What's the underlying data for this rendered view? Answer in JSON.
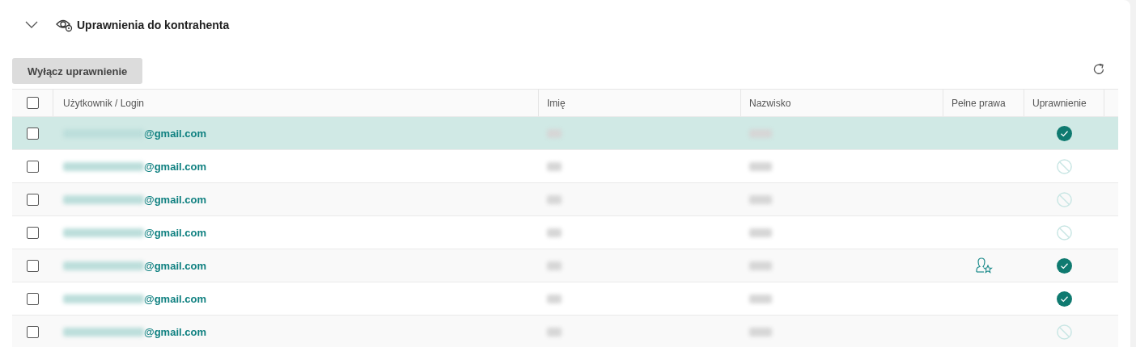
{
  "section": {
    "title": "Uprawnienia do kontrahenta",
    "expanded": true
  },
  "toolbar": {
    "button": "Wyłącz uprawnienie"
  },
  "table": {
    "header_checked": false,
    "columns": [
      "Użytkownik / Login",
      "Imię",
      "Nazwisko",
      "Pełne prawa",
      "Uprawnienie"
    ],
    "rows": [
      {
        "selected": true,
        "checked": false,
        "email_domain": "@gmail.com",
        "full_rights": false,
        "permission": true
      },
      {
        "selected": false,
        "checked": false,
        "email_domain": "@gmail.com",
        "full_rights": false,
        "permission": false
      },
      {
        "selected": false,
        "checked": false,
        "email_domain": "@gmail.com",
        "full_rights": false,
        "permission": false
      },
      {
        "selected": false,
        "checked": false,
        "email_domain": "@gmail.com",
        "full_rights": false,
        "permission": false
      },
      {
        "selected": false,
        "checked": false,
        "email_domain": "@gmail.com",
        "full_rights": true,
        "permission": true
      },
      {
        "selected": false,
        "checked": false,
        "email_domain": "@gmail.com",
        "full_rights": false,
        "permission": true
      },
      {
        "selected": false,
        "checked": false,
        "email_domain": "@gmail.com",
        "full_rights": false,
        "permission": false
      }
    ]
  }
}
